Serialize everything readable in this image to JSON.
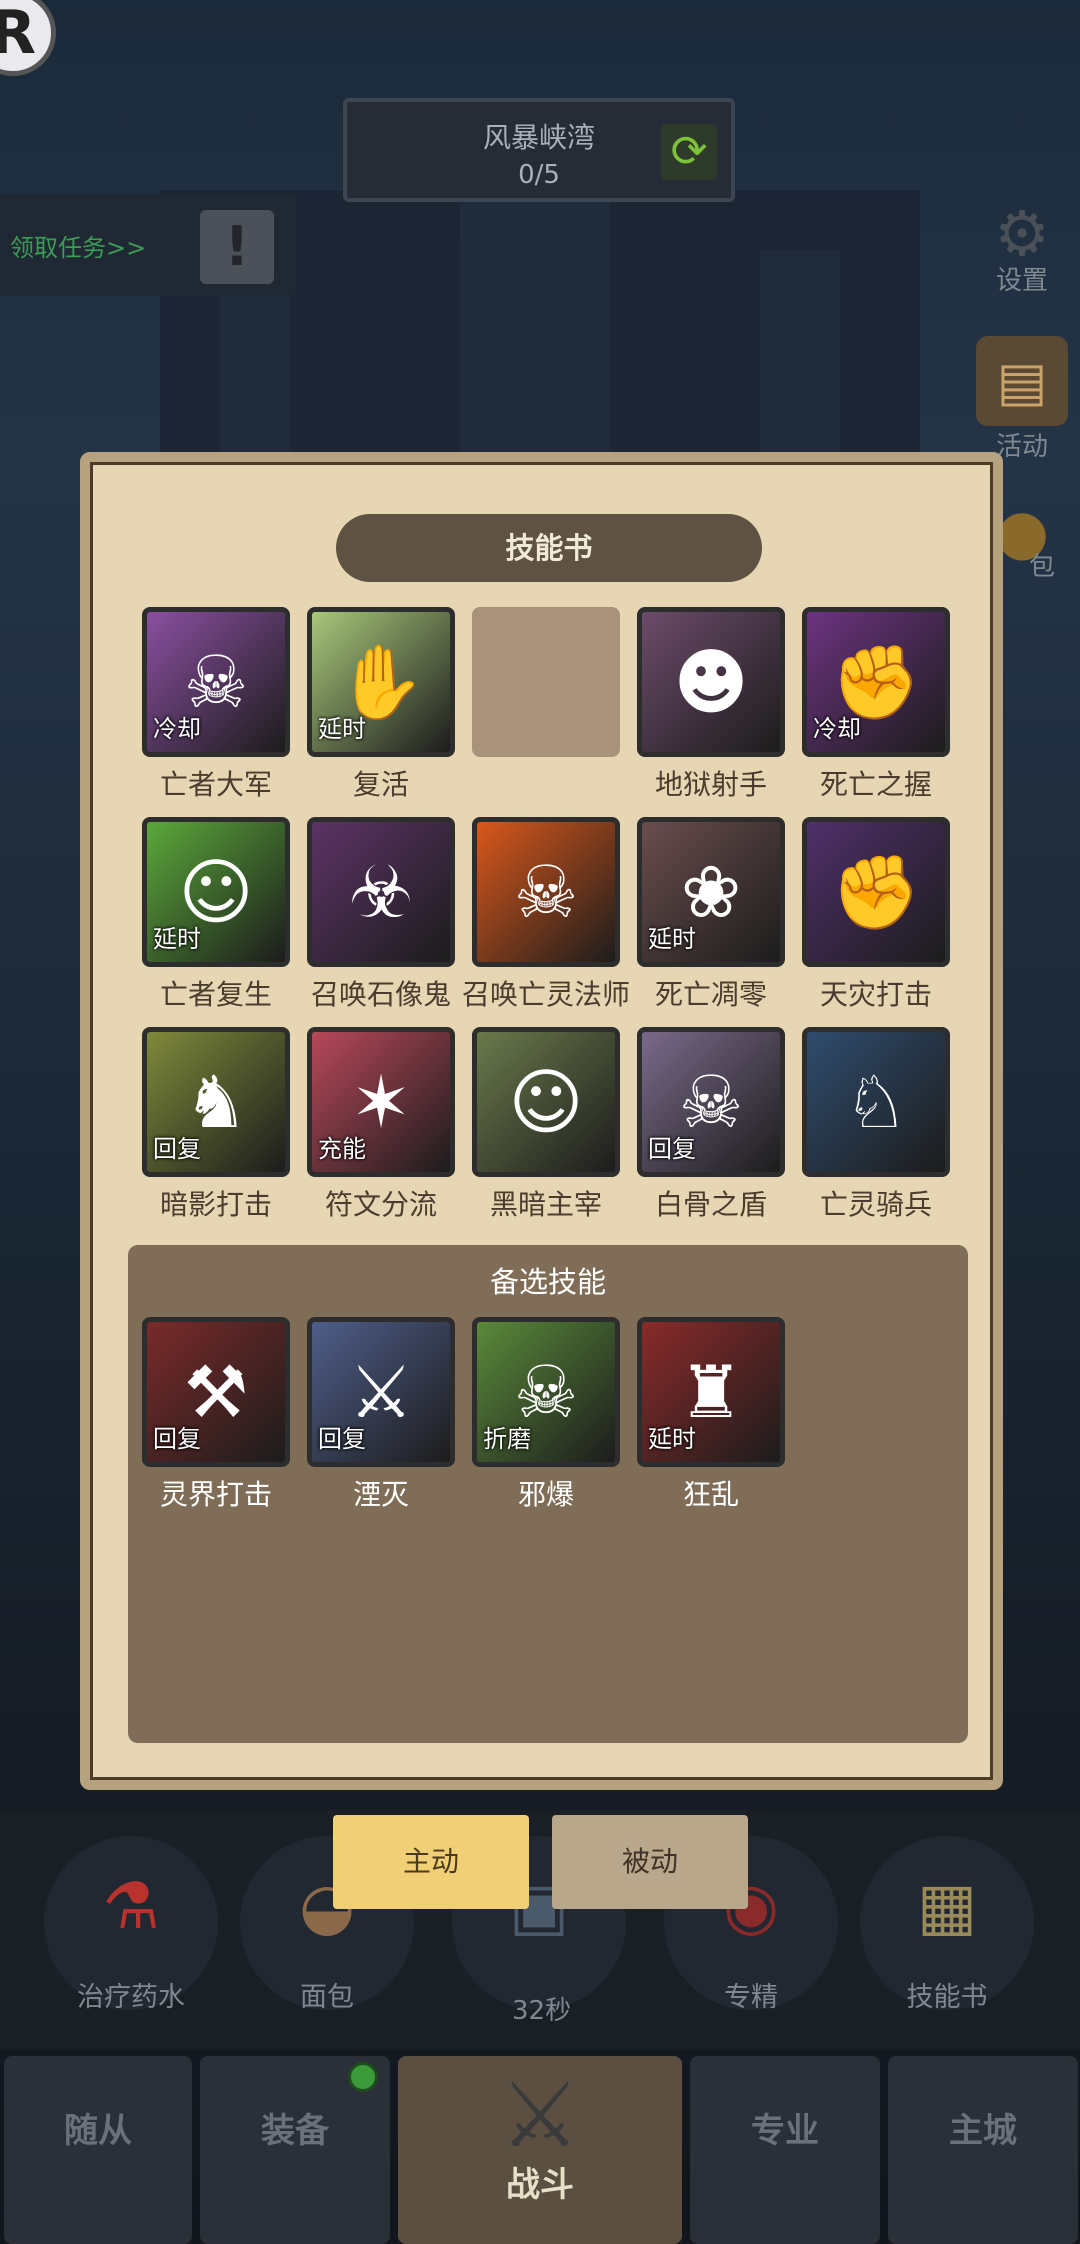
{
  "top": {
    "avatar_letter": "R",
    "stage_name": "风暴峡湾",
    "stage_progress": "0/5",
    "quest_link": "领取任务>>",
    "quest_icon": "!"
  },
  "side_menu": [
    {
      "label": "设置",
      "icon": "gear-icon"
    },
    {
      "label": "活动",
      "icon": "calendar-icon"
    },
    {
      "label": "包",
      "icon": "coin-bag-icon"
    }
  ],
  "modal": {
    "title": "技能书",
    "equipped": [
      {
        "name": "亡者大军",
        "tag": "冷却",
        "color": "#8a4fa0",
        "glyph": "☠"
      },
      {
        "name": "复活",
        "tag": "延时",
        "color": "#a8c77a",
        "glyph": "✋"
      },
      {
        "name": "",
        "tag": "",
        "color": "",
        "glyph": ""
      },
      {
        "name": "地狱射手",
        "tag": "",
        "color": "#6c4b6a",
        "glyph": "☻"
      },
      {
        "name": "死亡之握",
        "tag": "冷却",
        "color": "#6c3380",
        "glyph": "✊"
      },
      {
        "name": "亡者复生",
        "tag": "延时",
        "color": "#5ba83a",
        "glyph": "☺"
      },
      {
        "name": "召唤石像鬼",
        "tag": "",
        "color": "#5c3366",
        "glyph": "☣"
      },
      {
        "name": "召唤亡灵法师",
        "tag": "",
        "color": "#d9581b",
        "glyph": "☠"
      },
      {
        "name": "死亡凋零",
        "tag": "延时",
        "color": "#6a4d4d",
        "glyph": "❀"
      },
      {
        "name": "天灾打击",
        "tag": "",
        "color": "#4f2f6a",
        "glyph": "✊"
      },
      {
        "name": "暗影打击",
        "tag": "回复",
        "color": "#7f8a3a",
        "glyph": "♞"
      },
      {
        "name": "符文分流",
        "tag": "充能",
        "color": "#b7485a",
        "glyph": "✶"
      },
      {
        "name": "黑暗主宰",
        "tag": "",
        "color": "#6a7a4b",
        "glyph": "☺"
      },
      {
        "name": "白骨之盾",
        "tag": "回复",
        "color": "#7a6a8a",
        "glyph": "☠"
      },
      {
        "name": "亡灵骑兵",
        "tag": "",
        "color": "#2f4c6e",
        "glyph": "♘"
      }
    ],
    "alt_title": "备选技能",
    "alternates": [
      {
        "name": "灵界打击",
        "tag": "回复",
        "color": "#7a2a2a",
        "glyph": "⚒"
      },
      {
        "name": "湮灭",
        "tag": "回复",
        "color": "#4f5e8a",
        "glyph": "⚔"
      },
      {
        "name": "邪爆",
        "tag": "折磨",
        "color": "#5a8a3a",
        "glyph": "☠"
      },
      {
        "name": "狂乱",
        "tag": "延时",
        "color": "#8a2a2a",
        "glyph": "♜"
      }
    ]
  },
  "tabs": {
    "active": "主动",
    "passive": "被动"
  },
  "hud": {
    "items": [
      {
        "label": "治疗药水",
        "icon": "potion-icon"
      },
      {
        "label": "面包",
        "icon": "bread-icon"
      },
      {
        "label": "",
        "icon": "chest-icon"
      },
      {
        "label": "专精",
        "icon": "specialization-icon"
      },
      {
        "label": "技能书",
        "icon": "skill-book-icon"
      }
    ],
    "timer": "32秒"
  },
  "nav": {
    "followers": "随从",
    "equipment": "装备",
    "battle": "战斗",
    "profession": "专业",
    "main_city": "主城"
  }
}
